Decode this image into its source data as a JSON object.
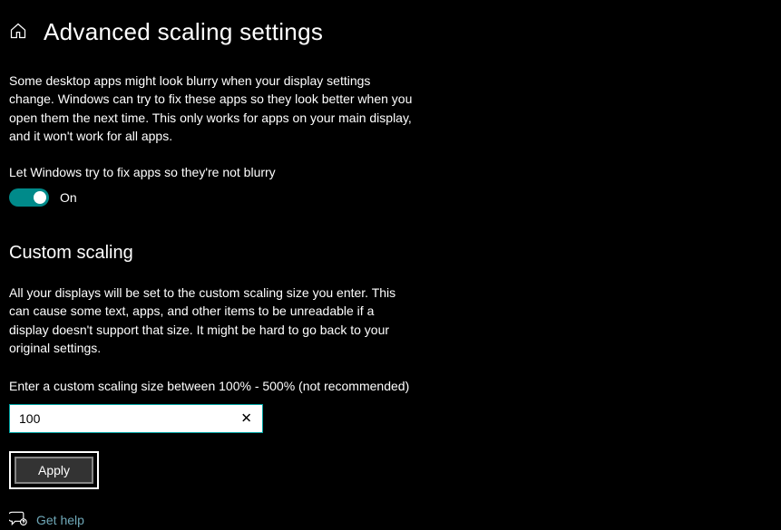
{
  "header": {
    "title": "Advanced scaling settings"
  },
  "blurry_fix": {
    "description": "Some desktop apps might look blurry when your display settings change. Windows can try to fix these apps so they look better when you open them the next time. This only works for apps on your main display, and it won't work for all apps.",
    "toggle_label": "Let Windows try to fix apps so they're not blurry",
    "toggle_state": "On"
  },
  "custom_scaling": {
    "title": "Custom scaling",
    "description": "All your displays will be set to the custom scaling size you enter. This can cause some text, apps, and other items to be unreadable if a display doesn't support that size. It might be hard to go back to your original settings.",
    "input_label": "Enter a custom scaling size between 100% - 500% (not recommended)",
    "input_value": "100",
    "apply_label": "Apply"
  },
  "footer": {
    "help_link": "Get help"
  }
}
